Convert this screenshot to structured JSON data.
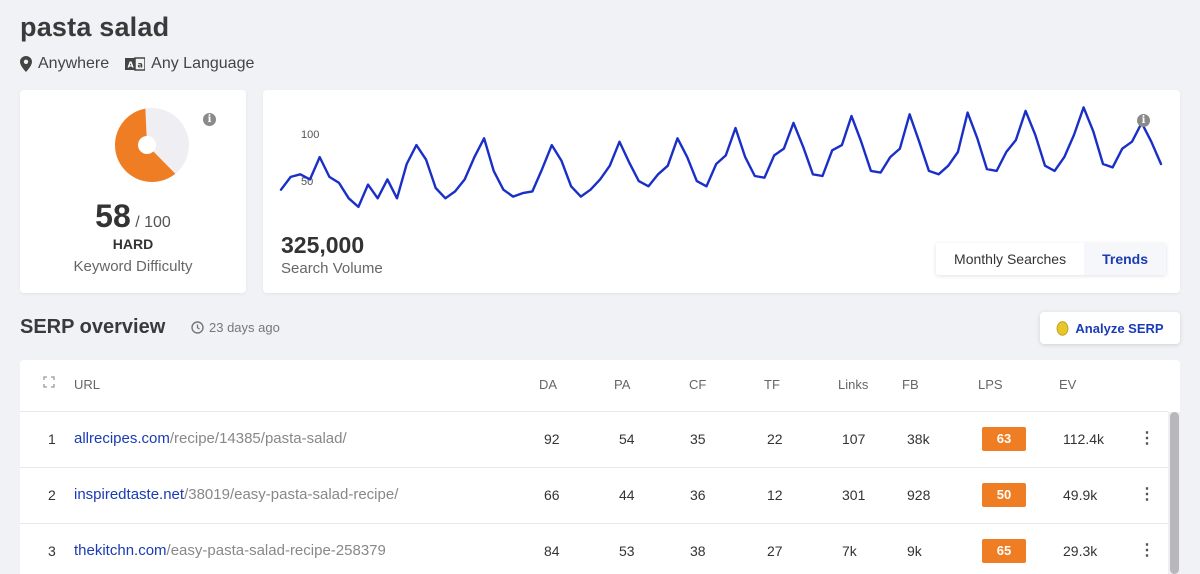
{
  "keyword": "pasta salad",
  "filters": {
    "location": "Anywhere",
    "language": "Any Language"
  },
  "difficulty": {
    "score": "58",
    "out_of": "/ 100",
    "level": "HARD",
    "caption": "Keyword Difficulty",
    "fraction": 0.58,
    "color": "#ef7d23"
  },
  "volume": {
    "value": "325,000",
    "caption": "Search Volume",
    "tabs": [
      "Monthly Searches",
      "Trends"
    ],
    "active_tab": "Trends",
    "y_ticks": [
      "100",
      "50"
    ]
  },
  "chart_data": {
    "type": "line",
    "series": [
      {
        "values": [
          40,
          55,
          58,
          52,
          78,
          55,
          48,
          30,
          20,
          46,
          30,
          52,
          30,
          70,
          92,
          75,
          42,
          30,
          38,
          52,
          78,
          100,
          62,
          40,
          32,
          36,
          38,
          64,
          92,
          74,
          44,
          32,
          40,
          52,
          68,
          96,
          72,
          50,
          44,
          58,
          68,
          100,
          78,
          50,
          44,
          70,
          80,
          112,
          78,
          56,
          54,
          80,
          88,
          118,
          90,
          58,
          56,
          86,
          92,
          126,
          96,
          62,
          60,
          78,
          88,
          128,
          96,
          62,
          58,
          68,
          84,
          130,
          100,
          64,
          62,
          84,
          98,
          132,
          104,
          68,
          62,
          78,
          104,
          136,
          108,
          70,
          66,
          88,
          96,
          118,
          96,
          70
        ]
      }
    ],
    "ylim": [
      0,
      140
    ],
    "color": "#1a2fc8"
  },
  "serp": {
    "title": "SERP overview",
    "updated": "23 days ago",
    "analyze_label": "Analyze SERP",
    "columns": [
      "URL",
      "DA",
      "PA",
      "CF",
      "TF",
      "Links",
      "FB",
      "LPS",
      "EV"
    ],
    "rows": [
      {
        "rank": "1",
        "domain": "allrecipes.com",
        "path": "/recipe/14385/pasta-salad/",
        "da": "92",
        "pa": "54",
        "cf": "35",
        "tf": "22",
        "links": "107",
        "fb": "38k",
        "lps": "63",
        "ev": "112.4k"
      },
      {
        "rank": "2",
        "domain": "inspiredtaste.net",
        "path": "/38019/easy-pasta-salad-recipe/",
        "da": "66",
        "pa": "44",
        "cf": "36",
        "tf": "12",
        "links": "301",
        "fb": "928",
        "lps": "50",
        "ev": "49.9k"
      },
      {
        "rank": "3",
        "domain": "thekitchn.com",
        "path": "/easy-pasta-salad-recipe-258379",
        "da": "84",
        "pa": "53",
        "cf": "38",
        "tf": "27",
        "links": "7k",
        "fb": "9k",
        "lps": "65",
        "ev": "29.3k"
      }
    ]
  }
}
